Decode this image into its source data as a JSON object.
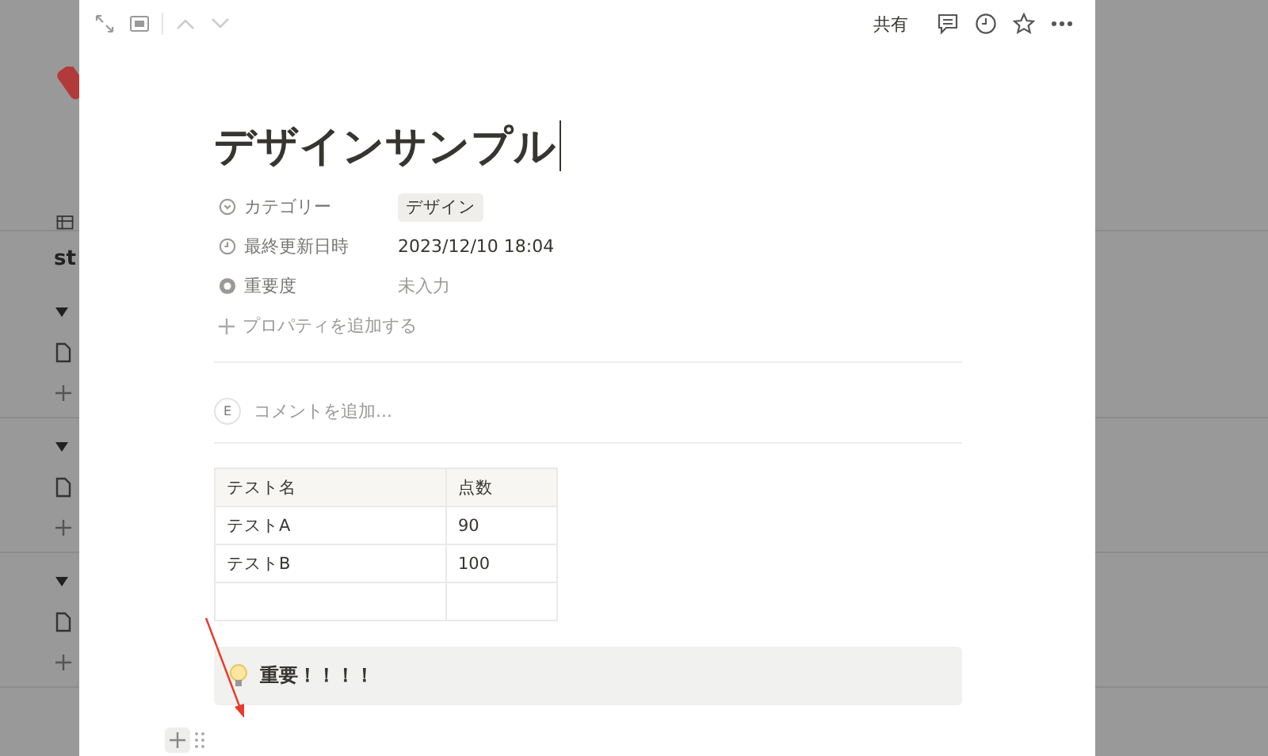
{
  "background": {
    "subheading": "st"
  },
  "toolbar": {
    "share": "共有"
  },
  "page": {
    "title": "デザインサンプル",
    "properties": [
      {
        "kind": "select",
        "label": "カテゴリー",
        "value": "デザイン"
      },
      {
        "kind": "date",
        "label": "最終更新日時",
        "value": "2023/12/10 18:04"
      },
      {
        "kind": "status",
        "label": "重要度",
        "value": "未入力"
      }
    ],
    "add_property": "プロパティを追加する",
    "comment": {
      "avatar": "E",
      "placeholder": "コメントを追加..."
    },
    "table": {
      "columns": [
        "テスト名",
        "点数"
      ],
      "rows": [
        {
          "kind": "data",
          "cells": [
            "テストA",
            "90"
          ]
        },
        {
          "kind": "data",
          "cells": [
            "テストB",
            "100"
          ]
        },
        {
          "kind": "blank"
        }
      ]
    },
    "callout": "重要！！！！"
  }
}
